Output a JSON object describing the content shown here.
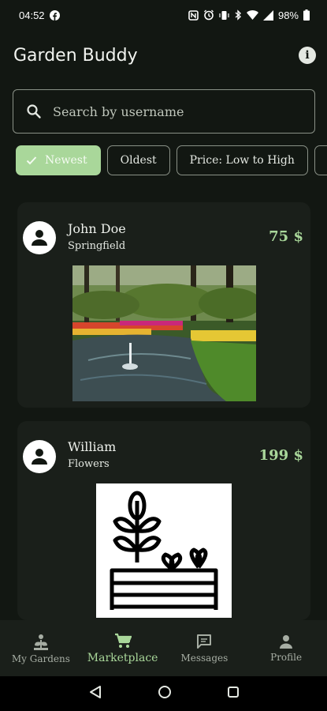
{
  "status_bar": {
    "time": "04:52",
    "battery": "98%"
  },
  "app": {
    "title": "Garden Buddy"
  },
  "search": {
    "placeholder": "Search by username"
  },
  "filters": [
    {
      "label": "Newest",
      "selected": true
    },
    {
      "label": "Oldest",
      "selected": false
    },
    {
      "label": "Price: Low to High",
      "selected": false
    }
  ],
  "listings": [
    {
      "name": "John Doe",
      "subtitle": "Springfield",
      "price": "75 $",
      "image": "garden-photo"
    },
    {
      "name": "William",
      "subtitle": "Flowers",
      "price": "199 $",
      "image": "plant-bed-icon"
    }
  ],
  "nav": [
    {
      "label": "My Gardens",
      "icon": "garden-icon",
      "active": false
    },
    {
      "label": "Marketplace",
      "icon": "cart-icon",
      "active": true
    },
    {
      "label": "Messages",
      "icon": "message-icon",
      "active": false
    },
    {
      "label": "Profile",
      "icon": "person-icon",
      "active": false
    }
  ],
  "colors": {
    "background": "#121712",
    "accent": "#a9d79a",
    "card": "#1a1f1a"
  }
}
